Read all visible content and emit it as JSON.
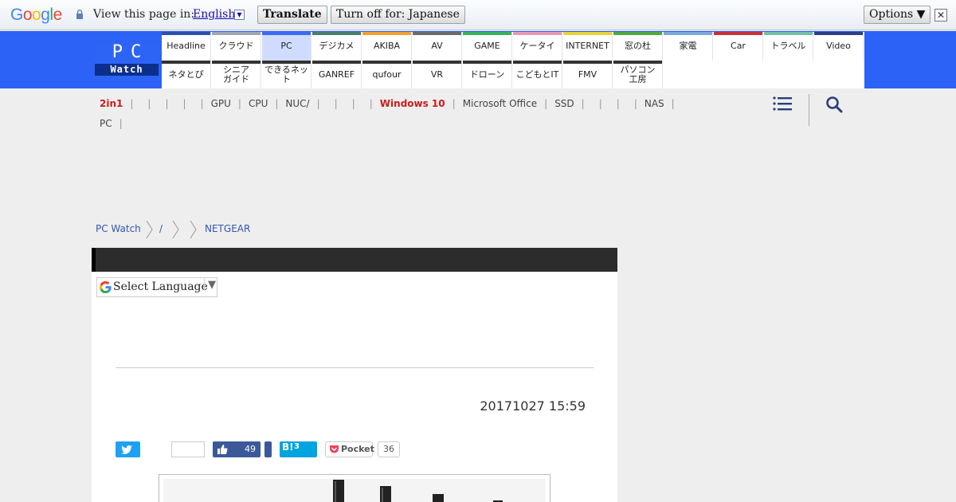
{
  "translate_bar": {
    "logo": "Google",
    "prompt": "View this page in:",
    "language": "English",
    "translate_button": "Translate",
    "turn_off_button": "Turn off for: Japanese",
    "options_button": "Options ▼",
    "close": "✕"
  },
  "logo": {
    "pc": "PC",
    "watch": "Watch"
  },
  "nav": {
    "row1": [
      {
        "label": "Headline",
        "color": "#2a4fae"
      },
      {
        "label": "クラウド",
        "color": "#9fa7b4"
      },
      {
        "label": "PC",
        "color": "#3a6bf0",
        "active": true
      },
      {
        "label": "デジカメ",
        "color": "#4a7d6e"
      },
      {
        "label": "AKIBA",
        "color": "#f0a030"
      },
      {
        "label": "AV",
        "color": "#6b6b6b"
      },
      {
        "label": "GAME",
        "color": "#36b35f"
      },
      {
        "label": "ケータイ",
        "color": "#e799b5"
      },
      {
        "label": "INTERNET",
        "color": "#e8d23a"
      },
      {
        "label": "窓の杜",
        "color": "#4ea93f"
      },
      {
        "label": "家電",
        "color": "#7aa9da"
      },
      {
        "label": "Car",
        "color": "#c8303a"
      },
      {
        "label": "トラベル",
        "color": "#72c0a8"
      },
      {
        "label": "Video",
        "color": "#2d3d8c"
      }
    ],
    "row2": [
      {
        "label": "ネタとぴ",
        "color": "#333333"
      },
      {
        "label": "シニア\nガイド",
        "color": "#333333"
      },
      {
        "label": "できるネット",
        "color": "#333333"
      },
      {
        "label": "GANREF",
        "color": "#333333"
      },
      {
        "label": "qufour",
        "color": "#333333"
      },
      {
        "label": "VR",
        "color": "#333333"
      },
      {
        "label": "ドローン",
        "color": "#333333"
      },
      {
        "label": "こどもとIT",
        "color": "#333333"
      },
      {
        "label": "FMV",
        "color": "#333333"
      },
      {
        "label": "パソコン\n工房",
        "color": "#333333"
      }
    ]
  },
  "tags": [
    {
      "label": "2in1",
      "red": true
    },
    {
      "label": ""
    },
    {
      "label": ""
    },
    {
      "label": ""
    },
    {
      "label": ""
    },
    {
      "label": "GPU"
    },
    {
      "label": "CPU"
    },
    {
      "label": "NUC/"
    },
    {
      "label": ""
    },
    {
      "label": ""
    },
    {
      "label": ""
    },
    {
      "label": "Windows 10",
      "red": true
    },
    {
      "label": "Microsoft Office"
    },
    {
      "label": "SSD"
    },
    {
      "label": ""
    },
    {
      "label": ""
    },
    {
      "label": ""
    },
    {
      "label": "NAS"
    },
    {
      "label": "PC"
    }
  ],
  "breadcrumb": {
    "home": "PC Watch",
    "slash": "/",
    "current": "NETGEAR"
  },
  "select_language": {
    "label": "Select Language",
    "arrow": "▼"
  },
  "article": {
    "date": "20171027 15:59"
  },
  "share": {
    "facebook_count": "49",
    "hatena_label": "B!",
    "hatena_count": "3",
    "pocket_label": "Pocket",
    "pocket_count": "36"
  }
}
